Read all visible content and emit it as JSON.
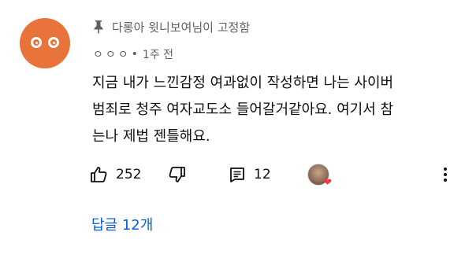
{
  "comment": {
    "pinned_label": "다롱아 윗니보여님이 고정함",
    "author": "ㅇㅇㅇ",
    "separator": "•",
    "time": "1주 전",
    "text": "지금 내가 느낀감정 여과없이 작성하면 나는 사이버\n범죄로 청주 여자교도소 들어갈거같아요. 여기서 참\n는나 제법 젠틀해요.",
    "like_count": "252",
    "reply_count": "12",
    "view_replies_label": "답글 12개"
  },
  "colors": {
    "avatar_bg": "#e8743b",
    "link": "#065fd4",
    "meta_text": "#606060",
    "heart": "#ff3340"
  },
  "icons": {
    "pin": "pin-icon",
    "like": "thumbs-up-icon",
    "dislike": "thumbs-down-icon",
    "reply": "comment-icon",
    "more": "more-vertical-icon"
  }
}
